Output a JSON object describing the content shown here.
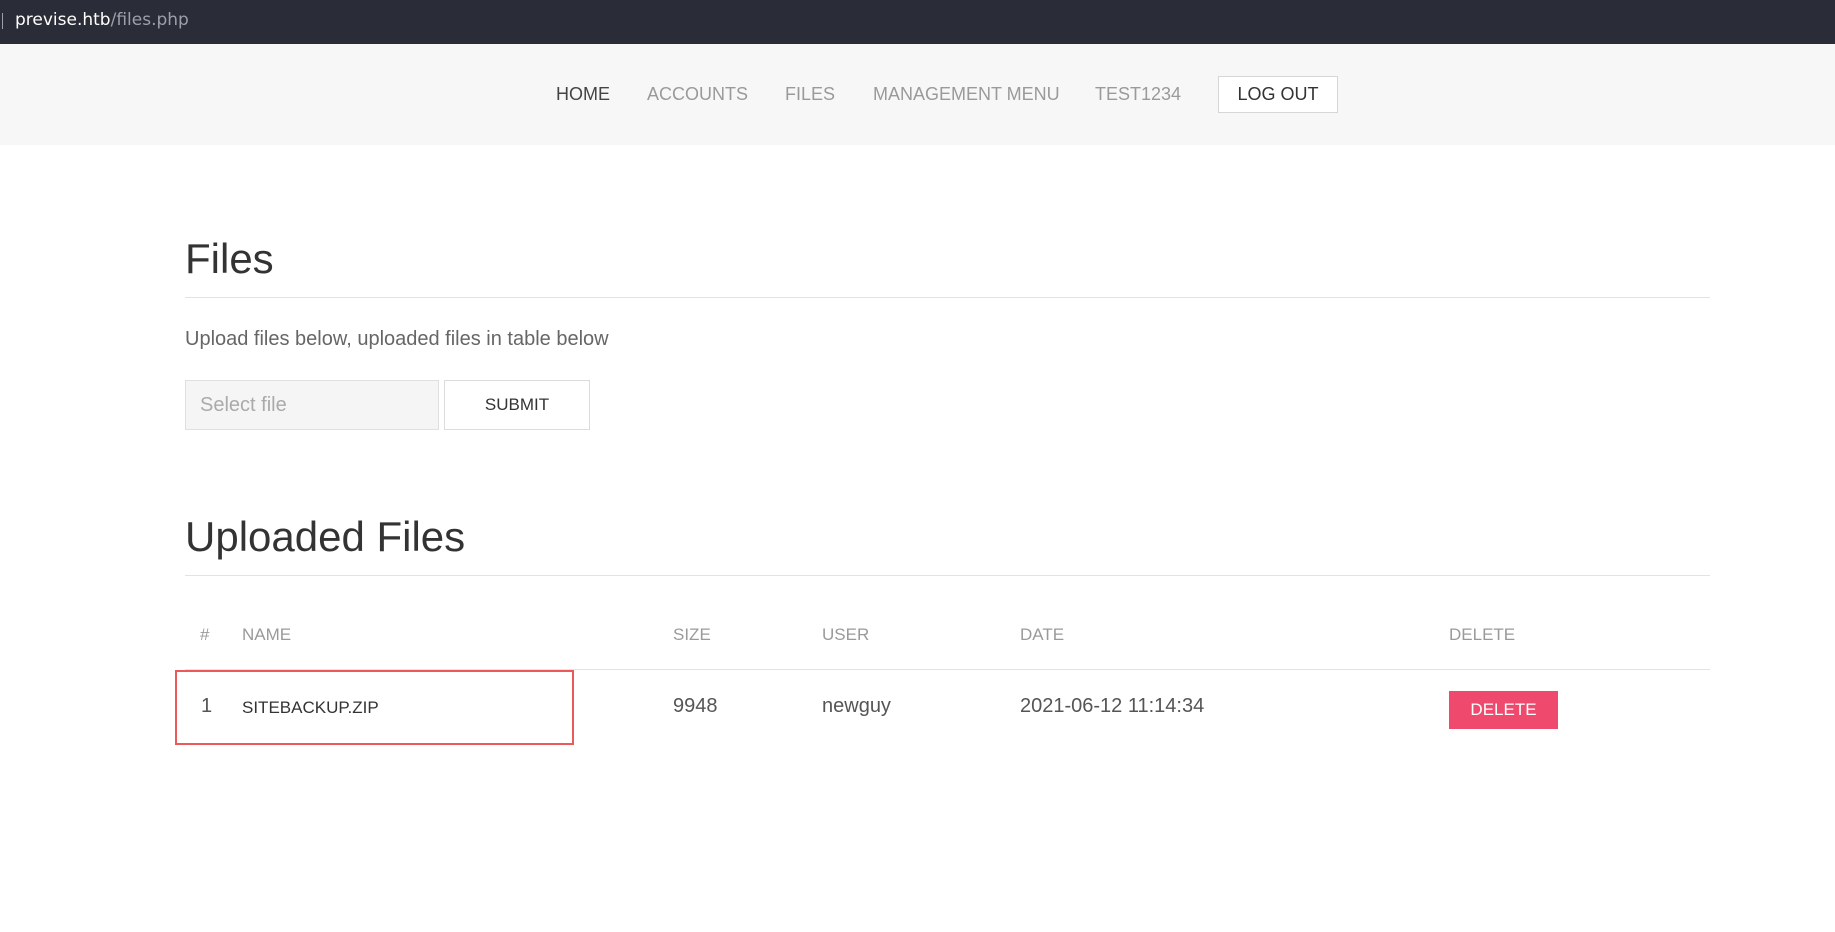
{
  "browser": {
    "url_host": "previse.htb",
    "url_path": "/files.php"
  },
  "nav": {
    "items": [
      {
        "label": "HOME",
        "active": true
      },
      {
        "label": "ACCOUNTS",
        "active": false
      },
      {
        "label": "FILES",
        "active": false
      },
      {
        "label": "MANAGEMENT MENU",
        "active": false
      },
      {
        "label": "TEST1234",
        "active": false
      }
    ],
    "logout_label": "LOG OUT"
  },
  "upload": {
    "title": "Files",
    "description": "Upload files below, uploaded files in table below",
    "file_input_placeholder": "Select file",
    "file_input_value": "",
    "submit_label": "SUBMIT"
  },
  "uploaded": {
    "title": "Uploaded Files",
    "columns": [
      "#",
      "NAME",
      "SIZE",
      "USER",
      "DATE",
      "DELETE"
    ],
    "rows": [
      {
        "num": "1",
        "name": "SITEBACKUP.ZIP",
        "size": "9948",
        "user": "newguy",
        "date": "2021-06-12 11:14:34",
        "delete_label": "DELETE"
      }
    ]
  },
  "colors": {
    "accent_delete": "#ef4a6d",
    "highlight": "#ea5a5a",
    "urlbar_bg": "#2a2c37",
    "nav_bg": "#f7f7f7"
  }
}
